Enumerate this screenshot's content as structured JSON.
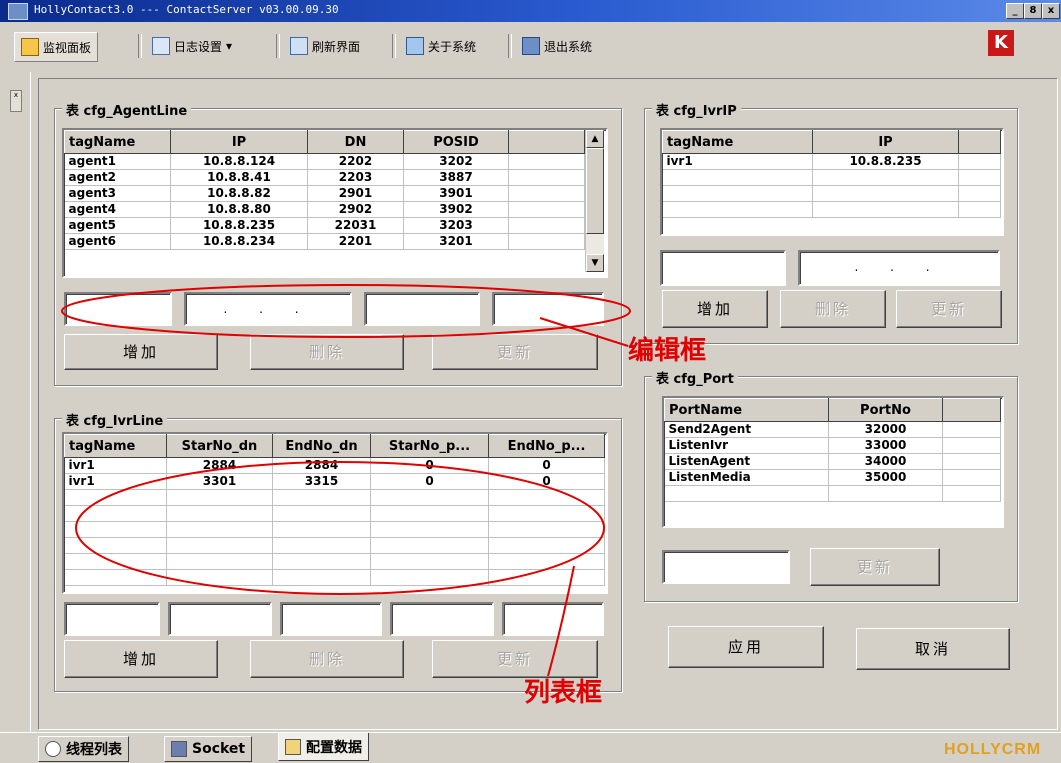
{
  "window": {
    "title": "HollyContact3.0 --- ContactServer v03.00.09.30",
    "min_glyph": "_",
    "max_glyph": "8",
    "close_glyph": "x"
  },
  "toolbar": {
    "items": [
      {
        "label": "监视面板",
        "icon": "monitor-panel-icon"
      },
      {
        "label": "日志设置",
        "icon": "log-settings-icon"
      },
      {
        "label": "刷新界面",
        "icon": "refresh-icon"
      },
      {
        "label": "关于系统",
        "icon": "about-icon"
      },
      {
        "label": "退出系统",
        "icon": "exit-icon"
      }
    ],
    "dropdown_glyph": "▾"
  },
  "agent_line": {
    "title": "表 cfg_AgentLine",
    "columns": [
      "tagName",
      "IP",
      "DN",
      "POSID"
    ],
    "rows": [
      [
        "agent1",
        "10.8.8.124",
        "2202",
        "3202"
      ],
      [
        "agent2",
        "10.8.8.41",
        "2203",
        "3887"
      ],
      [
        "agent3",
        "10.8.8.82",
        "2901",
        "3901"
      ],
      [
        "agent4",
        "10.8.8.80",
        "2902",
        "3902"
      ],
      [
        "agent5",
        "10.8.8.235",
        "22031",
        "3203"
      ],
      [
        "agent6",
        "10.8.8.234",
        "2201",
        "3201"
      ]
    ],
    "ip_mask": ". . .",
    "buttons": {
      "add": "增加",
      "delete": "删除",
      "update": "更新"
    }
  },
  "ivr_line": {
    "title": "表 cfg_IvrLine",
    "columns": [
      "tagName",
      "StarNo_dn",
      "EndNo_dn",
      "StarNo_p...",
      "EndNo_p..."
    ],
    "rows": [
      [
        "ivr1",
        "2884",
        "2884",
        "0",
        "0"
      ],
      [
        "ivr1",
        "3301",
        "3315",
        "0",
        "0"
      ]
    ],
    "buttons": {
      "add": "增加",
      "delete": "删除",
      "update": "更新"
    }
  },
  "ivr_ip": {
    "title": "表 cfg_IvrIP",
    "columns": [
      "tagName",
      "IP"
    ],
    "rows": [
      [
        "ivr1",
        "10.8.8.235"
      ]
    ],
    "ip_mask": ". . .",
    "buttons": {
      "add": "增加",
      "delete": "删除",
      "update": "更新"
    }
  },
  "port": {
    "title": "表 cfg_Port",
    "columns": [
      "PortName",
      "PortNo"
    ],
    "rows": [
      [
        "Send2Agent",
        "32000"
      ],
      [
        "ListenIvr",
        "33000"
      ],
      [
        "ListenAgent",
        "34000"
      ],
      [
        "ListenMedia",
        "35000"
      ]
    ],
    "buttons": {
      "update": "更新"
    }
  },
  "actions": {
    "apply": "应用",
    "cancel": "取消"
  },
  "annotations": {
    "edit_box": "编辑框",
    "list_box": "列表框",
    "color": "#e00000"
  },
  "status_tabs": [
    {
      "label": "线程列表",
      "icon": "thread-list-icon",
      "active": false
    },
    {
      "label": "Socket",
      "icon": "socket-icon",
      "active": false
    },
    {
      "label": "配置数据",
      "icon": "config-data-icon",
      "active": true
    }
  ],
  "brand": "HOLLYCRM",
  "dock_glyph": "x"
}
